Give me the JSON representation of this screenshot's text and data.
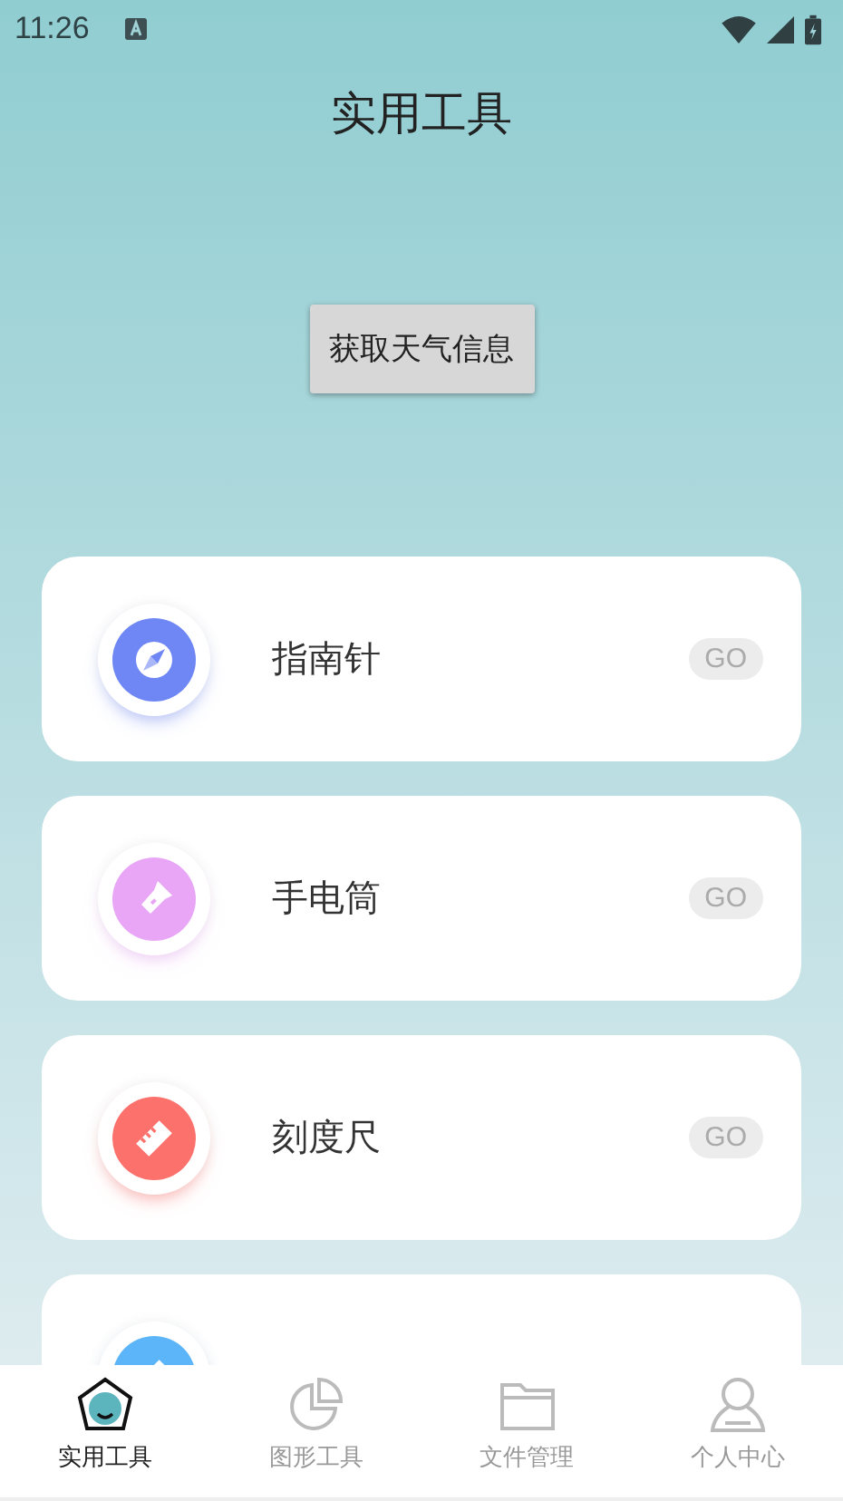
{
  "status_bar": {
    "time": "11:26"
  },
  "title": "实用工具",
  "weather_button": "获取天气信息",
  "tools": [
    {
      "kind": "compass",
      "label": "指南针",
      "action": "GO",
      "color": "#6f87f5"
    },
    {
      "kind": "flashlight",
      "label": "手电筒",
      "action": "GO",
      "color": "#e9a6f6"
    },
    {
      "kind": "ruler",
      "label": "刻度尺",
      "action": "GO",
      "color": "#fd716c"
    },
    {
      "kind": "rangefinder",
      "color": "#5cb5f8"
    }
  ],
  "tabs": [
    {
      "kind": "home",
      "label": "实用工具",
      "selected": true
    },
    {
      "kind": "chart",
      "label": "图形工具",
      "selected": false
    },
    {
      "kind": "folder",
      "label": "文件管理",
      "selected": false
    },
    {
      "kind": "person",
      "label": "个人中心",
      "selected": false
    }
  ]
}
